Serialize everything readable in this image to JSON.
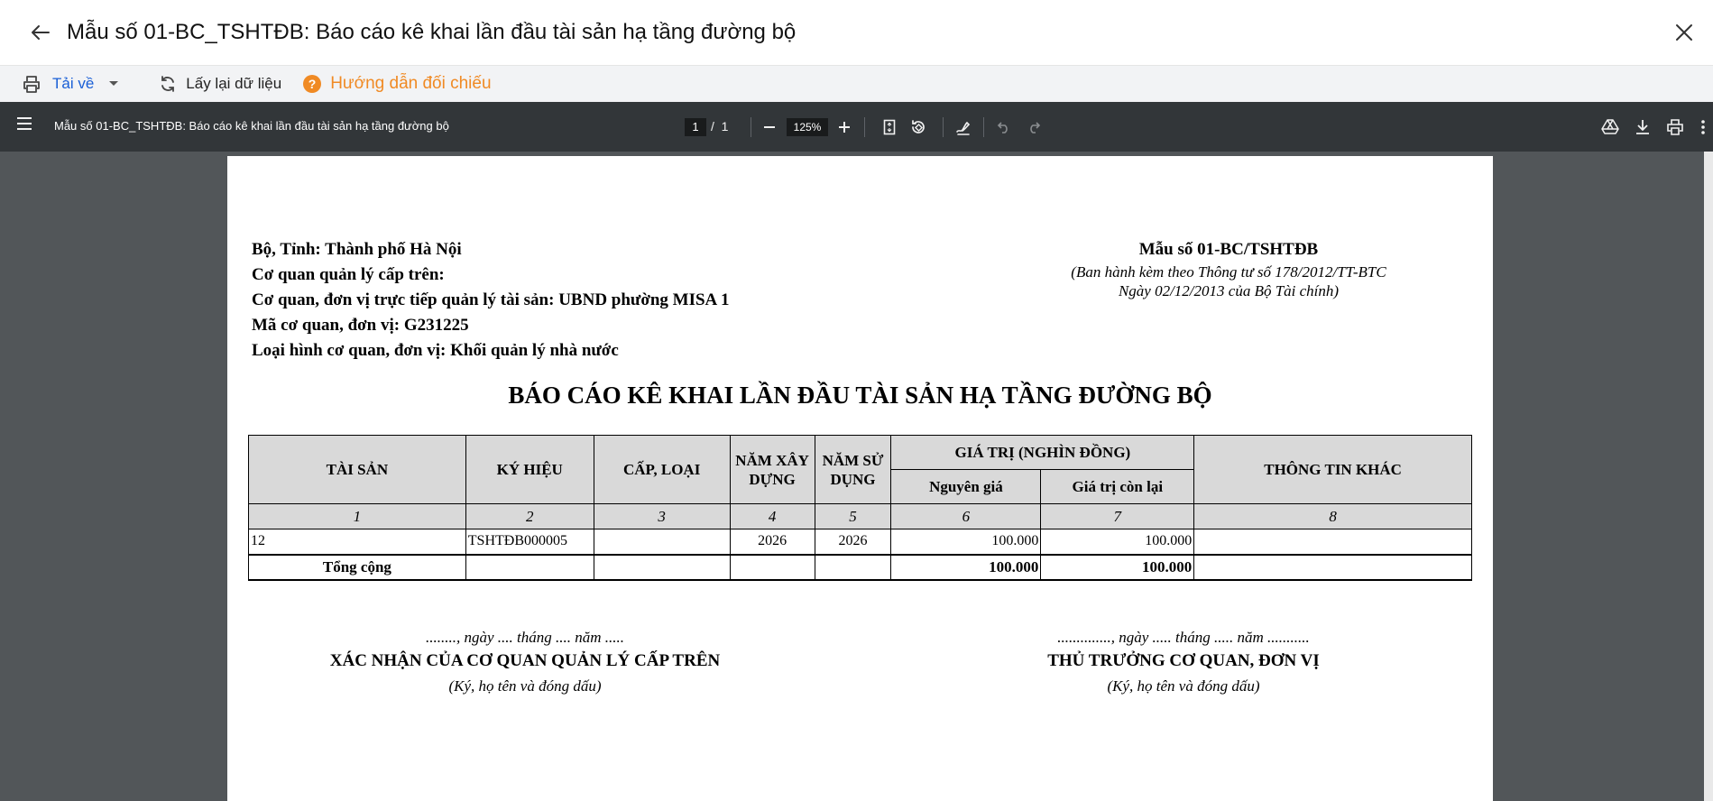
{
  "header": {
    "title": "Mẫu số 01-BC_TSHTĐB: Báo cáo kê khai lần đầu tài sản hạ tầng đường bộ"
  },
  "actions": {
    "download_label": "Tải về",
    "refresh_label": "Lấy lại dữ liệu",
    "guide_label": "Hướng dẫn đối chiếu"
  },
  "colors": {
    "accent": "#1a5fd6",
    "guide": "#f08a24",
    "pdf_toolbar": "#323639",
    "pdf_background": "#525659"
  },
  "viewer": {
    "doc_title": "Mẫu số 01-BC_TSHTĐB: Báo cáo kê khai lần đầu tài sản hạ tầng đường bộ",
    "current_page": "1",
    "page_separator": "/",
    "total_pages": "1",
    "zoom": "125%"
  },
  "report": {
    "left_header": {
      "line1": "Bộ, Tỉnh: Thành phố Hà Nội",
      "line2": "Cơ quan quản lý cấp trên:",
      "line3": "Cơ quan, đơn vị trực tiếp quản lý tài sản: UBND phường MISA 1",
      "line4": "Mã cơ quan, đơn vị: G231225",
      "line5": "Loại hình cơ quan, đơn vị: Khối quản lý nhà nước"
    },
    "form_no": "Mẫu số 01-BC/TSHTĐB",
    "form_note_1": "(Ban hành kèm theo Thông tư số 178/2012/TT-BTC",
    "form_note_2": "Ngày 02/12/2013 của Bộ Tài chính)",
    "title": "BÁO CÁO KÊ KHAI LẦN ĐẦU TÀI SẢN HẠ TẦNG ĐƯỜNG BỘ",
    "columns": {
      "asset": "TÀI SẢN",
      "code": "KÝ HIỆU",
      "grade": "CẤP, LOẠI",
      "year_built": "NĂM XÂY DỰNG",
      "year_used": "NĂM SỬ DỤNG",
      "value_group": "GIÁ TRỊ (NGHÌN ĐỒNG)",
      "original": "Nguyên giá",
      "remaining": "Giá trị còn lại",
      "other": "THÔNG TIN KHÁC"
    },
    "index_row": [
      "1",
      "2",
      "3",
      "4",
      "5",
      "6",
      "7",
      "8"
    ],
    "rows": [
      {
        "asset": "12",
        "code": "TSHTĐB000005",
        "grade": "",
        "year_built": "2026",
        "year_used": "2026",
        "original": "100.000",
        "remaining": "100.000",
        "other": ""
      }
    ],
    "total": {
      "label": "Tổng cộng",
      "original": "100.000",
      "remaining": "100.000"
    },
    "sign_left": {
      "date": "........, ngày .... tháng .... năm .....",
      "role": "XÁC NHẬN CỦA CƠ QUAN QUẢN LÝ CẤP TRÊN",
      "hint": "(Ký, họ tên và đóng dấu)"
    },
    "sign_right": {
      "date": ".............., ngày ..... tháng ..... năm ...........",
      "role": "THỦ TRƯỞNG CƠ QUAN, ĐƠN VỊ",
      "hint": "(Ký, họ tên và đóng dấu)"
    }
  }
}
